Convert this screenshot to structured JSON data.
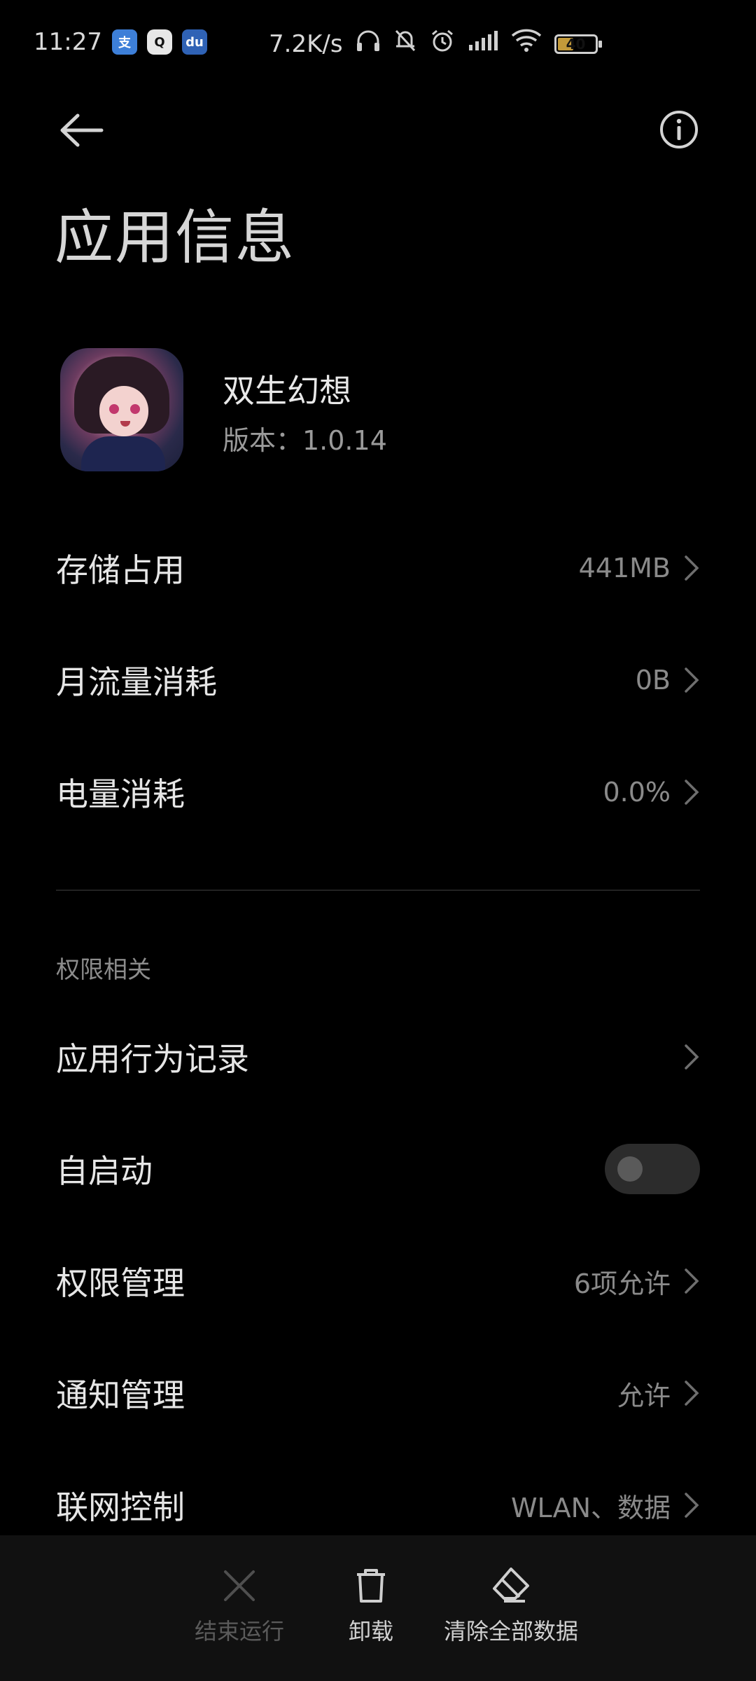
{
  "status_bar": {
    "time": "11:27",
    "app_icons": [
      "alipay-icon",
      "qq-icon",
      "baidu-icon"
    ],
    "app_icon_glyphs": [
      "支",
      "Q",
      "du"
    ],
    "network_speed": "7.2K/s",
    "battery_level": "40"
  },
  "page": {
    "title": "应用信息"
  },
  "app": {
    "name": "双生幻想",
    "version": "版本：1.0.14"
  },
  "usage_rows": [
    {
      "label": "存储占用",
      "value": "441MB"
    },
    {
      "label": "月流量消耗",
      "value": "0B"
    },
    {
      "label": "电量消耗",
      "value": "0.0%"
    }
  ],
  "permissions_section": {
    "label": "权限相关",
    "rows": [
      {
        "label": "应用行为记录",
        "value": ""
      },
      {
        "label": "自启动",
        "toggle": false
      },
      {
        "label": "权限管理",
        "value": "6项允许"
      },
      {
        "label": "通知管理",
        "value": "允许"
      },
      {
        "label": "联网控制",
        "value": "WLAN、数据"
      }
    ]
  },
  "bottom_bar": {
    "stop": {
      "label": "结束运行",
      "enabled": false
    },
    "uninstall": {
      "label": "卸载",
      "enabled": true
    },
    "clear": {
      "label": "清除全部数据",
      "enabled": true
    }
  },
  "colors": {
    "background": "#000000",
    "text_primary": "#e6e6e6",
    "text_secondary": "#8a8a8a",
    "bottom_bar": "#111111"
  }
}
